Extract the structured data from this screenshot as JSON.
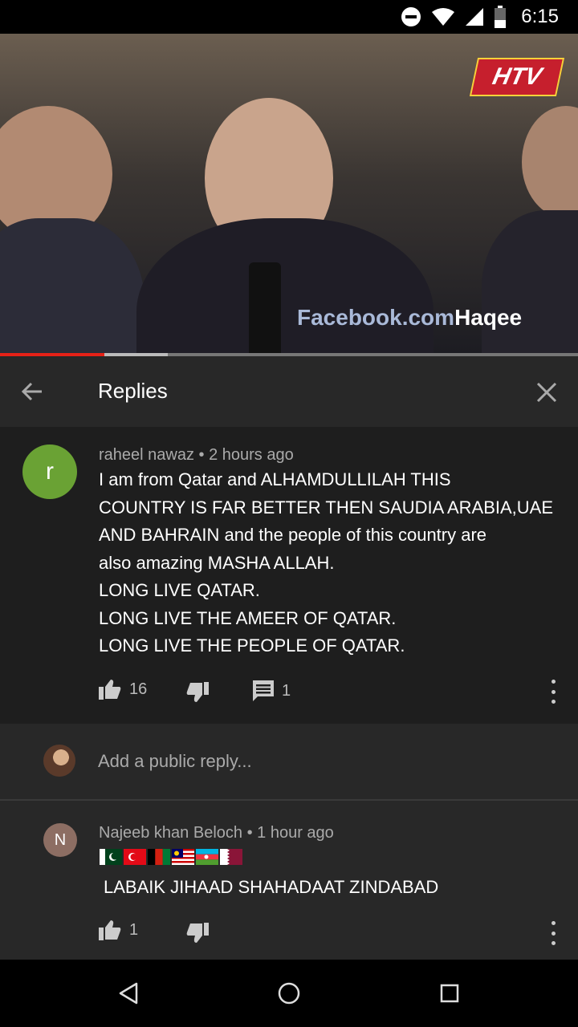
{
  "status_bar": {
    "time": "6:15"
  },
  "video": {
    "channel_logo": "HTV",
    "watermark_prefix": "Facebook.com",
    "watermark_suffix": "Haqee",
    "progress_played": 0.18,
    "progress_buffered": 0.29
  },
  "header": {
    "title": "Replies"
  },
  "main_comment": {
    "avatar_letter": "r",
    "avatar_color": "#6aa234",
    "author": "raheel nawaz",
    "time": "2 hours ago",
    "lines": [
      "I am from Qatar and ALHAMDULLILAH THIS",
      "COUNTRY IS FAR BETTER THEN SAUDIA ARABIA,UAE",
      "AND BAHRAIN and the people of this country are",
      "also amazing MASHA ALLAH.",
      "LONG LIVE QATAR.",
      "LONG LIVE THE AMEER OF QATAR.",
      "LONG LIVE THE PEOPLE OF QATAR."
    ],
    "likes": "16",
    "reply_count": "1"
  },
  "reply_input": {
    "placeholder": "Add a public reply..."
  },
  "reply_comment": {
    "avatar_letter": "N",
    "avatar_color": "#8d6e63",
    "author": "Najeeb khan Beloch",
    "time": "1 hour ago",
    "flags": [
      "pakistan-flag",
      "turkey-flag",
      "afghanistan-flag",
      "malaysia-flag",
      "azerbaijan-flag",
      "qatar-flag"
    ],
    "text": "LABAIK JIHAAD SHAHADAAT ZINDABAD",
    "likes": "1"
  }
}
